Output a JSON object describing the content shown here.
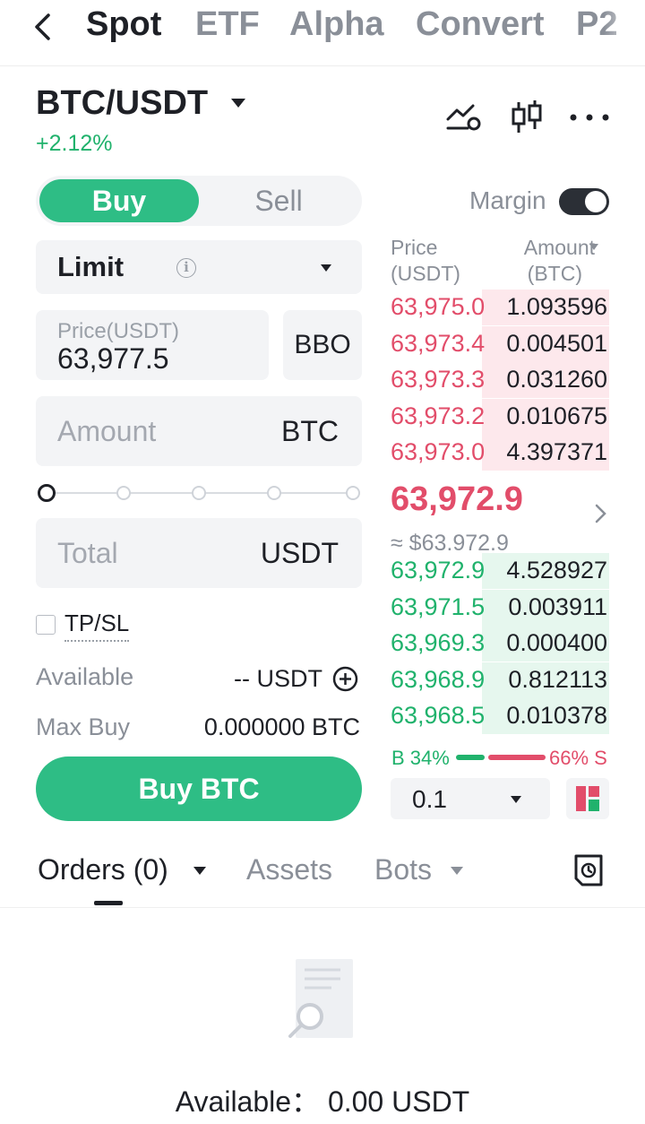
{
  "nav": {
    "tabs": [
      {
        "label": "Spot",
        "active": true
      },
      {
        "label": "ETF",
        "active": false
      },
      {
        "label": "Alpha",
        "active": false
      },
      {
        "label": "Convert",
        "active": false
      },
      {
        "label": "P2",
        "active": false
      }
    ]
  },
  "header": {
    "pair": "BTC/USDT",
    "change": "+2.12%",
    "icons": [
      "chart-indicator-icon",
      "candlestick-icon",
      "more-icon"
    ]
  },
  "trade": {
    "buy_label": "Buy",
    "sell_label": "Sell",
    "margin_label": "Margin",
    "margin_on": true,
    "order_type": "Limit",
    "price_placeholder": "Price(USDT)",
    "price_value": "63,977.5",
    "bbo_label": "BBO",
    "amount_placeholder": "Amount",
    "amount_unit": "BTC",
    "slider_percent": 0,
    "total_placeholder": "Total",
    "total_unit": "USDT",
    "tpsl_label": "TP/SL",
    "available_label": "Available",
    "available_value": "-- USDT",
    "max_buy_label": "Max Buy",
    "max_buy_value": "0.000000 BTC",
    "submit_label": "Buy BTC"
  },
  "orderbook": {
    "price_header": "Price",
    "price_unit": "(USDT)",
    "amount_header": "Amount",
    "amount_unit": "(BTC)",
    "asks": [
      {
        "price": "63,975.0",
        "amount": "1.093596",
        "depth": 0.58
      },
      {
        "price": "63,973.4",
        "amount": "0.004501",
        "depth": 0.58
      },
      {
        "price": "63,973.3",
        "amount": "0.031260",
        "depth": 0.58
      },
      {
        "price": "63,973.2",
        "amount": "0.010675",
        "depth": 0.58
      },
      {
        "price": "63,973.0",
        "amount": "4.397371",
        "depth": 0.58
      }
    ],
    "last_price": "63,972.9",
    "last_price_usd": "≈ $63,972.9",
    "bids": [
      {
        "price": "63,972.9",
        "amount": "4.528927",
        "depth": 0.58
      },
      {
        "price": "63,971.5",
        "amount": "0.003911",
        "depth": 0.58
      },
      {
        "price": "63,969.3",
        "amount": "0.000400",
        "depth": 0.58
      },
      {
        "price": "63,968.9",
        "amount": "0.812113",
        "depth": 0.58
      },
      {
        "price": "63,968.5",
        "amount": "0.010378",
        "depth": 0.58
      }
    ],
    "buy_ratio": "B 34%",
    "sell_ratio": "66% S",
    "buy_ratio_value": 34,
    "sell_ratio_value": 66,
    "depth_step": "0.1"
  },
  "bottom": {
    "tabs": [
      {
        "label": "Orders (0)",
        "active": true
      },
      {
        "label": "Assets",
        "active": false
      },
      {
        "label": "Bots",
        "active": false
      }
    ],
    "available_text": "Available： 0.00 USDT"
  },
  "colors": {
    "buy": "#2ebd85",
    "sell": "#e24d6a",
    "text": "#1e2026",
    "muted": "#8a8f98"
  }
}
